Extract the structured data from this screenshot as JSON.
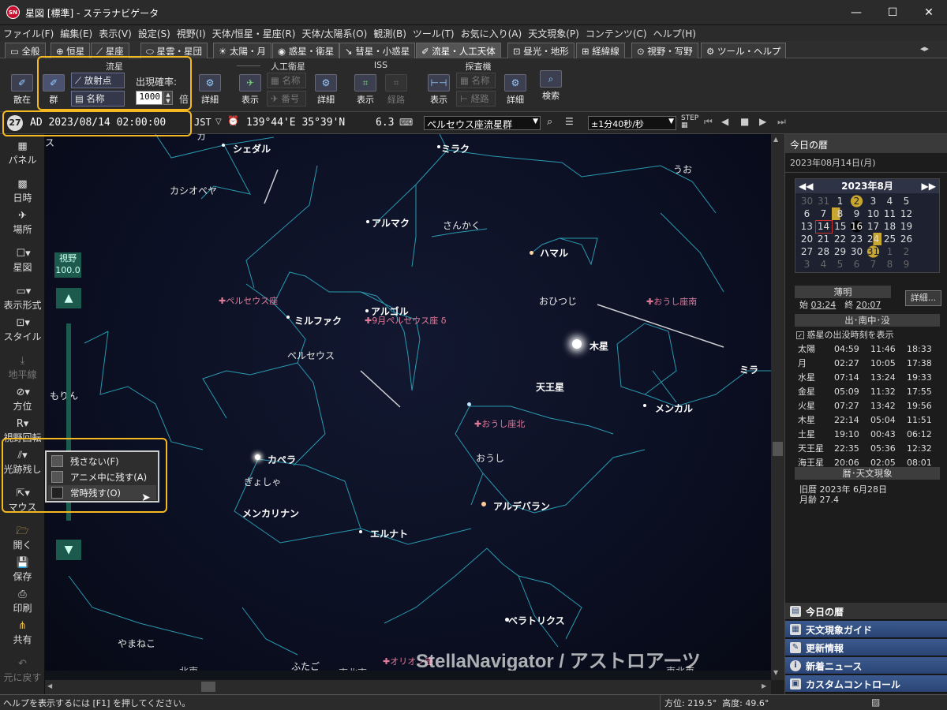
{
  "window": {
    "title": "星図 [標準] - ステラナビゲータ",
    "app_icon": "SN"
  },
  "menu": [
    "ファイル(F)",
    "編集(E)",
    "表示(V)",
    "設定(S)",
    "視野(I)",
    "天体/恒星・星座(R)",
    "天体/太陽系(O)",
    "観測(B)",
    "ツール(T)",
    "お気に入り(A)",
    "天文現象(P)",
    "コンテンツ(C)",
    "ヘルプ(H)"
  ],
  "tabs": [
    "全般",
    "恒星",
    "星座",
    "星雲・星団",
    "太陽・月",
    "惑星・衛星",
    "彗星・小惑星",
    "流星・人工天体",
    "昼光・地形",
    "経緯線",
    "視野・写野",
    "ツール・ヘルプ"
  ],
  "active_tab": 7,
  "ribbon": {
    "meteor_group": "流星",
    "sporadic": "散在",
    "shower": "群",
    "radiant": "放射点",
    "name": "名称",
    "rate_label": "出現確率:",
    "rate_value": "1000",
    "rate_unit": "倍",
    "detail": "詳細",
    "satellite_group": "人工衛星",
    "show": "表示",
    "sat_name": "名称",
    "number": "番号",
    "iss_group": "ISS",
    "path": "経路",
    "probe_group": "探査機",
    "search": "検索"
  },
  "statusrow": {
    "day": "27",
    "datetime": "AD 2023/08/14 02:00:00",
    "tz": "JST",
    "tz_arrow": "▽",
    "location": "139°44'E 35°39'N",
    "magnitude": "6.3",
    "target": "ペルセウス座流星群",
    "step": "±1分40秒/秒"
  },
  "sidebar": {
    "panel": "パネル",
    "datetime": "日時",
    "place": "場所",
    "chart": "星図",
    "display": "表示形式",
    "style": "スタイル",
    "horizon": "地平線",
    "direction": "方位",
    "rotation": "視野回転",
    "trail": "光跡残し",
    "mouse": "マウス",
    "open": "開く",
    "save": "保存",
    "print": "印刷",
    "share": "共有",
    "undo": "元に戻す"
  },
  "fov": {
    "label": "視野",
    "value": "100.0"
  },
  "popup": {
    "items": [
      "残さない(F)",
      "アニメ中に残す(A)",
      "常時残す(O)"
    ]
  },
  "sky_labels": {
    "shedar": "シェダル",
    "mirach": "ミラク",
    "cassiopeia": "カシオペヤ",
    "almach": "アルマク",
    "triangle": "さんかく",
    "pisces": "うお",
    "hamal": "ハマル",
    "aries": "おひつじ",
    "perseus_rad": "ペルセウス座",
    "mirfak": "ミルファク",
    "algol": "アルゴル",
    "delta_per": "9月ペルセウス座 δ",
    "perseus": "ペルセウス",
    "aurigids_s": "おうし座南",
    "jupiter": "木星",
    "uranus": "天王星",
    "mira": "ミラ",
    "menkar": "メンカル",
    "lynx": "やまねこ",
    "taurus_n": "おうし座北",
    "capella": "カペラ",
    "auriga": "ぎょしゃ",
    "taurus": "おうし",
    "menkalinan": "メンカリナン",
    "aldebaran": "アルデバラン",
    "elnath": "エルナト",
    "bellatrix": "ベラトリクス",
    "lynx2": "やまねこ",
    "gemini": "ふたご",
    "orionids": "オリオン座",
    "orion": "オリオン",
    "northeast": "北東",
    "east_northeast": "東北東",
    "north": "北東",
    "east": "東北東",
    "edge_left": "もりん",
    "edge_top": "ス",
    "edge_right": "ミラ",
    "hidden_tag": "カ",
    "watermark": "StellaNavigator / アストロアーツ"
  },
  "right_panel": {
    "header": "今日の暦",
    "date": "2023年08月14日(月)",
    "cal_title": "2023年8月",
    "weeks": [
      [
        "30",
        "31",
        "1",
        "2",
        "3",
        "4",
        "5"
      ],
      [
        "6",
        "7",
        "8",
        "9",
        "10",
        "11",
        "12"
      ],
      [
        "13",
        "14",
        "15",
        "16",
        "17",
        "18",
        "19"
      ],
      [
        "20",
        "21",
        "22",
        "23",
        "24",
        "25",
        "26"
      ],
      [
        "27",
        "28",
        "29",
        "30",
        "31",
        "1",
        "2"
      ],
      [
        "3",
        "4",
        "5",
        "6",
        "7",
        "8",
        "9"
      ]
    ],
    "twilight": "薄明",
    "start_lbl": "始",
    "start": "03:24",
    "end_lbl": "終",
    "end": "20:07",
    "detail_btn": "詳細...",
    "rise_head": "出･南中･没",
    "show_planet_times": "惑星の出没時刻を表示",
    "rise_rows": [
      [
        "太陽",
        "04:59",
        "11:46",
        "18:33"
      ],
      [
        "月",
        "02:27",
        "10:05",
        "17:38"
      ],
      [
        "水星",
        "07:14",
        "13:24",
        "19:33"
      ],
      [
        "金星",
        "05:09",
        "11:32",
        "17:55"
      ],
      [
        "火星",
        "07:27",
        "13:42",
        "19:56"
      ],
      [
        "木星",
        "22:14",
        "05:04",
        "11:51"
      ],
      [
        "土星",
        "19:10",
        "00:43",
        "06:12"
      ],
      [
        "天王星",
        "22:35",
        "05:36",
        "12:32"
      ],
      [
        "海王星",
        "20:06",
        "02:05",
        "08:01"
      ]
    ],
    "calendar_head": "暦･天文現象",
    "old_cal_lbl": "旧暦",
    "old_cal": "2023年 6月28日",
    "moon_age_lbl": "月齢",
    "moon_age": "27.4",
    "nav": [
      "今日の暦",
      "天文現象ガイド",
      "更新情報",
      "新着ニュース",
      "カスタムコントロール"
    ]
  },
  "footer": {
    "help": "ヘルプを表示するには [F1] を押してください。",
    "coords": "方位: 219.5°  高度: 49.6°"
  },
  "colors": {
    "highlight": "#f5b821",
    "constellation": "#2fb1c8",
    "navbar": "#2a4574"
  }
}
